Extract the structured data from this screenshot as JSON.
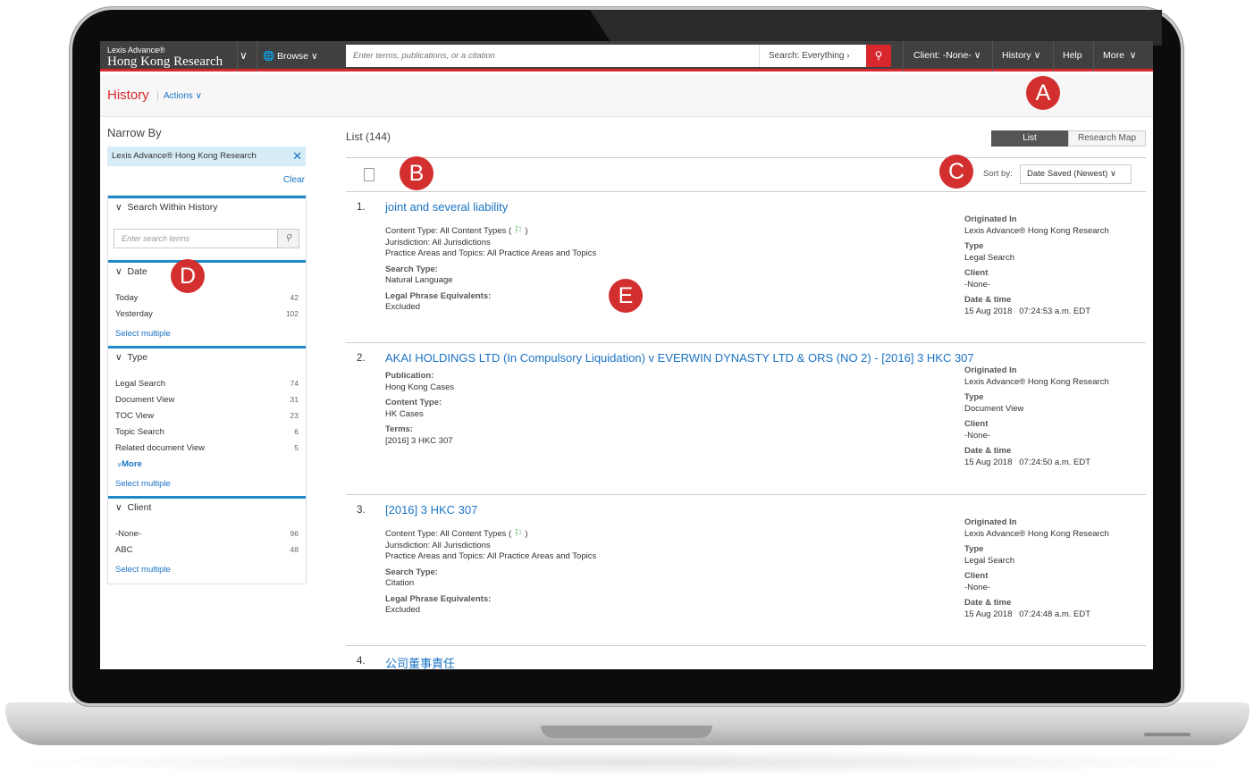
{
  "app": {
    "logo_line1": "Lexis Advance®",
    "logo_line2": "Hong Kong Research",
    "browse": "Browse"
  },
  "search": {
    "placeholder": "Enter terms, publications, or a citation",
    "scope": "Search: Everything"
  },
  "nav": {
    "client": "Client: -None-",
    "history": "History",
    "help": "Help",
    "more": "More"
  },
  "page": {
    "title": "History",
    "actions": "Actions"
  },
  "narrow": {
    "title": "Narrow By",
    "filter": "Lexis Advance® Hong Kong Research",
    "clear": "Clear"
  },
  "search_within": {
    "header": "Search Within History",
    "placeholder": "Enter search terms"
  },
  "date": {
    "header": "Date",
    "rows": [
      {
        "label": "Today",
        "count": "42"
      },
      {
        "label": "Yesterday",
        "count": "102"
      }
    ],
    "select": "Select multiple"
  },
  "type": {
    "header": "Type",
    "rows": [
      {
        "label": "Legal Search",
        "count": "74"
      },
      {
        "label": "Document View",
        "count": "31"
      },
      {
        "label": "TOC View",
        "count": "23"
      },
      {
        "label": "Topic Search",
        "count": "6"
      },
      {
        "label": "Related document View",
        "count": "5"
      }
    ],
    "more": "More",
    "select": "Select multiple"
  },
  "client": {
    "header": "Client",
    "rows": [
      {
        "label": "-None-",
        "count": "96"
      },
      {
        "label": "ABC",
        "count": "48"
      }
    ],
    "select": "Select multiple"
  },
  "list": {
    "header": "List (144)",
    "toggle_list": "List",
    "toggle_map": "Research Map",
    "sort_label": "Sort by:",
    "sort_value": "Date Saved (Newest)"
  },
  "items": [
    {
      "num": "1.",
      "title": "joint and several liability",
      "l1": "Content Type: All Content Types (",
      "l1b": ")",
      "l2": "Jurisdiction: All Jurisdictions",
      "l3": "Practice Areas and Topics: All Practice Areas and Topics",
      "k1": "Search Type:",
      "v1": "Natural Language",
      "k2": "Legal Phrase Equivalents:",
      "v2": "Excluded",
      "orig_k": "Originated In",
      "orig_v": "Lexis Advance® Hong Kong Research",
      "type_k": "Type",
      "type_v": "Legal Search",
      "client_k": "Client",
      "client_v": "-None-",
      "date_k": "Date & time",
      "date_v": "15 Aug 2018   07:24:53 a.m. EDT"
    },
    {
      "num": "2.",
      "title": "AKAI HOLDINGS LTD (In Compulsory Liquidation) v EVERWIN DYNASTY LTD & ORS (NO 2) - [2016] 3 HKC 307",
      "k1": "Publication:",
      "v1": "Hong Kong Cases",
      "k2": "Content Type:",
      "v2": "HK Cases",
      "k3": "Terms:",
      "v3": "[2016] 3 HKC 307",
      "orig_k": "Originated In",
      "orig_v": "Lexis Advance® Hong Kong Research",
      "type_k": "Type",
      "type_v": "Document View",
      "client_k": "Client",
      "client_v": "-None-",
      "date_k": "Date & time",
      "date_v": "15 Aug 2018   07:24:50 a.m. EDT"
    },
    {
      "num": "3.",
      "title": "[2016] 3 HKC 307",
      "l1": "Content Type: All Content Types (",
      "l1b": ")",
      "l2": "Jurisdiction: All Jurisdictions",
      "l3": "Practice Areas and Topics: All Practice Areas and Topics",
      "k1": "Search Type:",
      "v1": "Citation",
      "k2": "Legal Phrase Equivalents:",
      "v2": "Excluded",
      "orig_k": "Originated In",
      "orig_v": "Lexis Advance® Hong Kong Research",
      "type_k": "Type",
      "type_v": "Legal Search",
      "client_k": "Client",
      "client_v": "-None-",
      "date_k": "Date & time",
      "date_v": "15 Aug 2018   07:24:48 a.m. EDT"
    },
    {
      "num": "4.",
      "title": "公司董事責任"
    }
  ],
  "badges": {
    "a": "A",
    "b": "B",
    "c": "C",
    "d": "D",
    "e": "E"
  },
  "colors": {
    "accent": "#d9272e",
    "link": "#1a73c4",
    "badge": "#d32f2f"
  }
}
